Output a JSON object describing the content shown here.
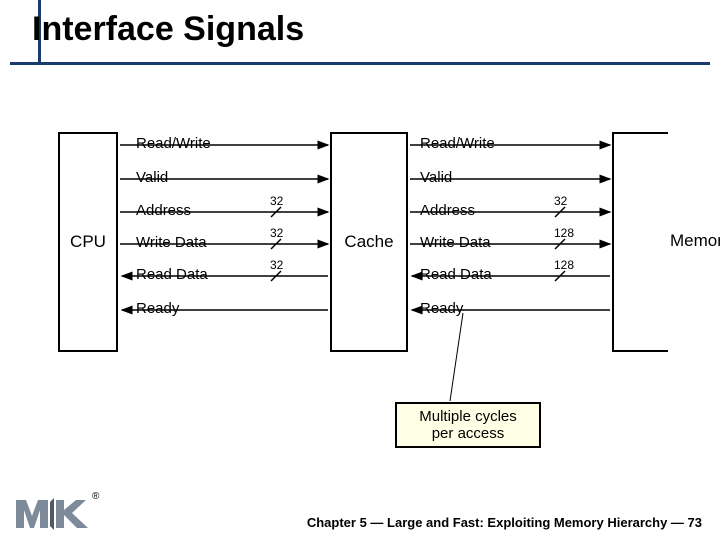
{
  "title": "Interface Signals",
  "cpu_label": "CPU",
  "cache_label": "Cache",
  "memory_label": "Memory",
  "signals_left": {
    "rw": {
      "label": "Read/Write"
    },
    "valid": {
      "label": "Valid"
    },
    "addr": {
      "label": "Address",
      "bits": "32"
    },
    "wdata": {
      "label": "Write Data",
      "bits": "32"
    },
    "rdata": {
      "label": "Read Data",
      "bits": "32"
    },
    "ready": {
      "label": "Ready"
    }
  },
  "signals_right": {
    "rw": {
      "label": "Read/Write"
    },
    "valid": {
      "label": "Valid"
    },
    "addr": {
      "label": "Address",
      "bits": "32"
    },
    "wdata": {
      "label": "Write Data",
      "bits": "128"
    },
    "rdata": {
      "label": "Read Data",
      "bits": "128"
    },
    "ready": {
      "label": "Ready"
    }
  },
  "annotation": "Multiple cycles\nper access",
  "footer": "Chapter 5 — Large and Fast: Exploiting Memory Hierarchy — 73",
  "colors": {
    "blue": "#1A3B6E",
    "accent_yellow": "#FFFFE5"
  }
}
